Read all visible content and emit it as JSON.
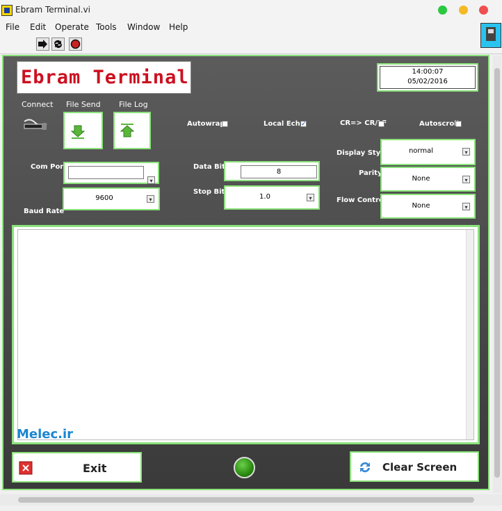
{
  "window": {
    "title": "Ebram Terminal.vi"
  },
  "menu": [
    "File",
    "Edit",
    "Operate",
    "Tools",
    "Window",
    "Help"
  ],
  "colors": {
    "accent_green": "#8ae27a",
    "title_red": "#cc1020",
    "watermark_blue": "#1a86d0"
  },
  "front_panel": {
    "title": "Ebram Terminal",
    "time": "14:00:07",
    "date": "05/02/2016",
    "connect_label": "Connect",
    "file_send_label": "File Send",
    "file_log_label": "File Log",
    "autowrap_label": "Autowrap",
    "local_echo_label": "Local Echo",
    "crlf_label": "CR=> CR/LF",
    "autoscroll_label": "Autoscroll",
    "com_port_label": "Com Port",
    "com_port_value": "",
    "baud_rate_label": "Baud Rate",
    "baud_rate_value": "9600",
    "data_bits_label": "Data Bits",
    "data_bits_value": "8",
    "stop_bits_label": "Stop Bits",
    "stop_bits_value": "1.0",
    "display_style_label": "Display Style",
    "display_style_value": "normal",
    "parity_label": "Parity",
    "parity_value": "None",
    "flow_control_label": "Flow Control",
    "flow_control_value": "None",
    "watermark": "Melec.ir",
    "exit_label": "Exit",
    "clear_screen_label": "Clear Screen",
    "checkboxes": {
      "autowrap": false,
      "local_echo": true,
      "crlf": false,
      "autoscroll": false
    }
  }
}
